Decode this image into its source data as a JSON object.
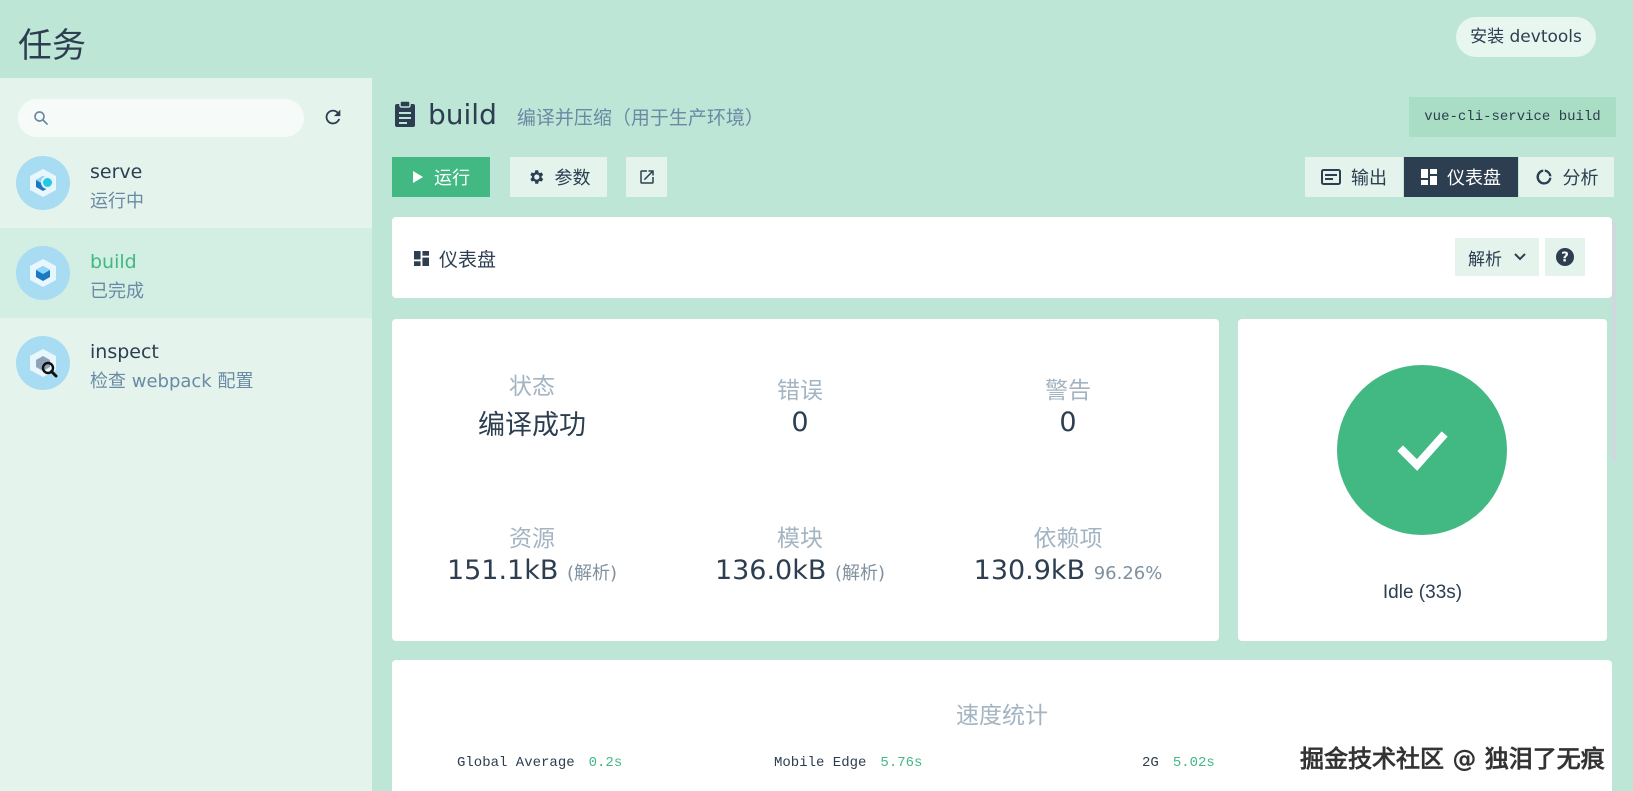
{
  "header": {
    "title": "任务",
    "devtools_button": "安装 devtools"
  },
  "sidebar": {
    "search": {
      "placeholder": "",
      "value": ""
    },
    "tasks": [
      {
        "name": "serve",
        "description": "运行中",
        "status": "running"
      },
      {
        "name": "build",
        "description": "已完成",
        "status": "done",
        "selected": true
      },
      {
        "name": "inspect",
        "description": "检查 webpack 配置"
      }
    ]
  },
  "main": {
    "task_title": "build",
    "task_subtitle": "编译并压缩（用于生产环境）",
    "command": "vue-cli-service build",
    "toolbar": {
      "run": "运行",
      "params": "参数",
      "output": "输出",
      "dashboard": "仪表盘",
      "analyze": "分析"
    },
    "dashboard": {
      "title": "仪表盘",
      "select_value": "解析",
      "stats": {
        "status_label": "状态",
        "status_value": "编译成功",
        "errors_label": "错误",
        "errors_value": "0",
        "warnings_label": "警告",
        "warnings_value": "0",
        "assets_label": "资源",
        "assets_value": "151.1kB",
        "assets_sub": "(解析)",
        "modules_label": "模块",
        "modules_value": "136.0kB",
        "modules_sub": "(解析)",
        "deps_label": "依赖项",
        "deps_value": "130.9kB",
        "deps_sub": "96.26%"
      },
      "status_text": "Idle (33s)",
      "speed": {
        "title": "速度统计",
        "items": [
          {
            "label": "Global Average",
            "value": "0.2s"
          },
          {
            "label": "Mobile Edge",
            "value": "5.76s"
          },
          {
            "label": "2G",
            "value": "5.02s"
          }
        ]
      }
    }
  },
  "watermark": "掘金技术社区 @ 独泪了无痕",
  "colors": {
    "accent": "#42b983",
    "dark": "#2c3e50",
    "background": "#bde6d6"
  }
}
